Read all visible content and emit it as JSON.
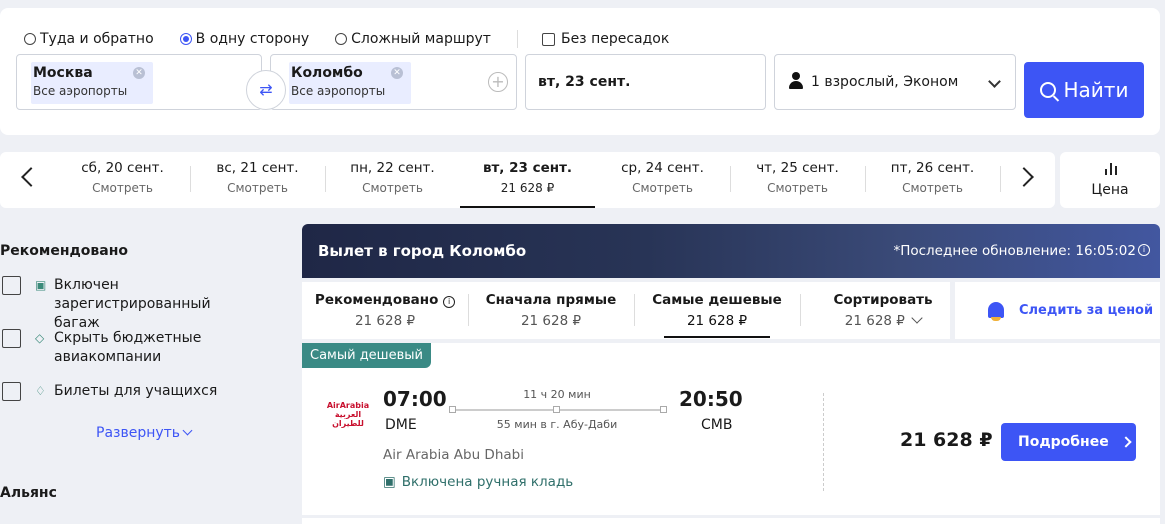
{
  "search": {
    "trip_types": [
      {
        "label": "Туда и обратно",
        "selected": false
      },
      {
        "label": "В одну сторону",
        "selected": true
      },
      {
        "label": "Сложный маршрут",
        "selected": false
      }
    ],
    "nonstop_label": "Без пересадок",
    "from": {
      "city": "Москва",
      "sub": "Все аэропорты"
    },
    "to": {
      "city": "Коломбо",
      "sub": "Все аэропорты"
    },
    "date": "вт, 23 сент.",
    "passengers": "1 взрослый, Эконом",
    "find_label": "Найти"
  },
  "dates": [
    {
      "day": "сб, 20 сент.",
      "sub": "Смотреть",
      "active": false
    },
    {
      "day": "вс, 21 сент.",
      "sub": "Смотреть",
      "active": false
    },
    {
      "day": "пн, 22 сент.",
      "sub": "Смотреть",
      "active": false
    },
    {
      "day": "вт, 23 сент.",
      "sub": "21 628 ₽",
      "active": true
    },
    {
      "day": "ср, 24 сент.",
      "sub": "Смотреть",
      "active": false
    },
    {
      "day": "чт, 25 сент.",
      "sub": "Смотреть",
      "active": false
    },
    {
      "day": "пт, 26 сент.",
      "sub": "Смотреть",
      "active": false
    }
  ],
  "price_button": "Цена",
  "filters": {
    "title": "Рекомендовано",
    "items": [
      {
        "label": "Включен зарегистрированный багаж",
        "icon": "luggage-icon"
      },
      {
        "label": "Скрыть бюджетные авиакомпании",
        "icon": "tag-icon"
      },
      {
        "label": "Билеты для учащихся",
        "icon": "graduation-cap-icon"
      }
    ],
    "expand": "Развернуть",
    "alliance_title": "Альянс"
  },
  "banner": {
    "title": "Вылет в город Коломбо",
    "updated": "*Последнее обновление: 16:05:02"
  },
  "sort": [
    {
      "label": "Рекомендовано",
      "value": "21 628 ₽",
      "active": false
    },
    {
      "label": "Сначала прямые",
      "value": "21 628 ₽",
      "active": false
    },
    {
      "label": "Самые дешевые",
      "value": "21 628 ₽",
      "active": true
    },
    {
      "label": "Сортировать",
      "value": "21 628 ₽",
      "active": false
    }
  ],
  "watch_label": "Следить за ценой",
  "flight": {
    "tag": "Самый дешевый",
    "airline_logo": "AirArabia",
    "airline_logo_ar": "العربية للطيران",
    "depart_time": "07:00",
    "depart_airport": "DME",
    "arrive_time": "20:50",
    "arrive_airport": "CMB",
    "duration": "11 ч 20 мин",
    "stopover": "55 мин в г. Абу-Даби",
    "airline": "Air Arabia Abu Dhabi",
    "baggage": "Включена ручная кладь",
    "price": "21 628 ₽",
    "details_label": "Подробнее"
  },
  "colors": {
    "accent": "#3d55f5",
    "tag": "#3a8a85",
    "banner": "#1f2746"
  }
}
